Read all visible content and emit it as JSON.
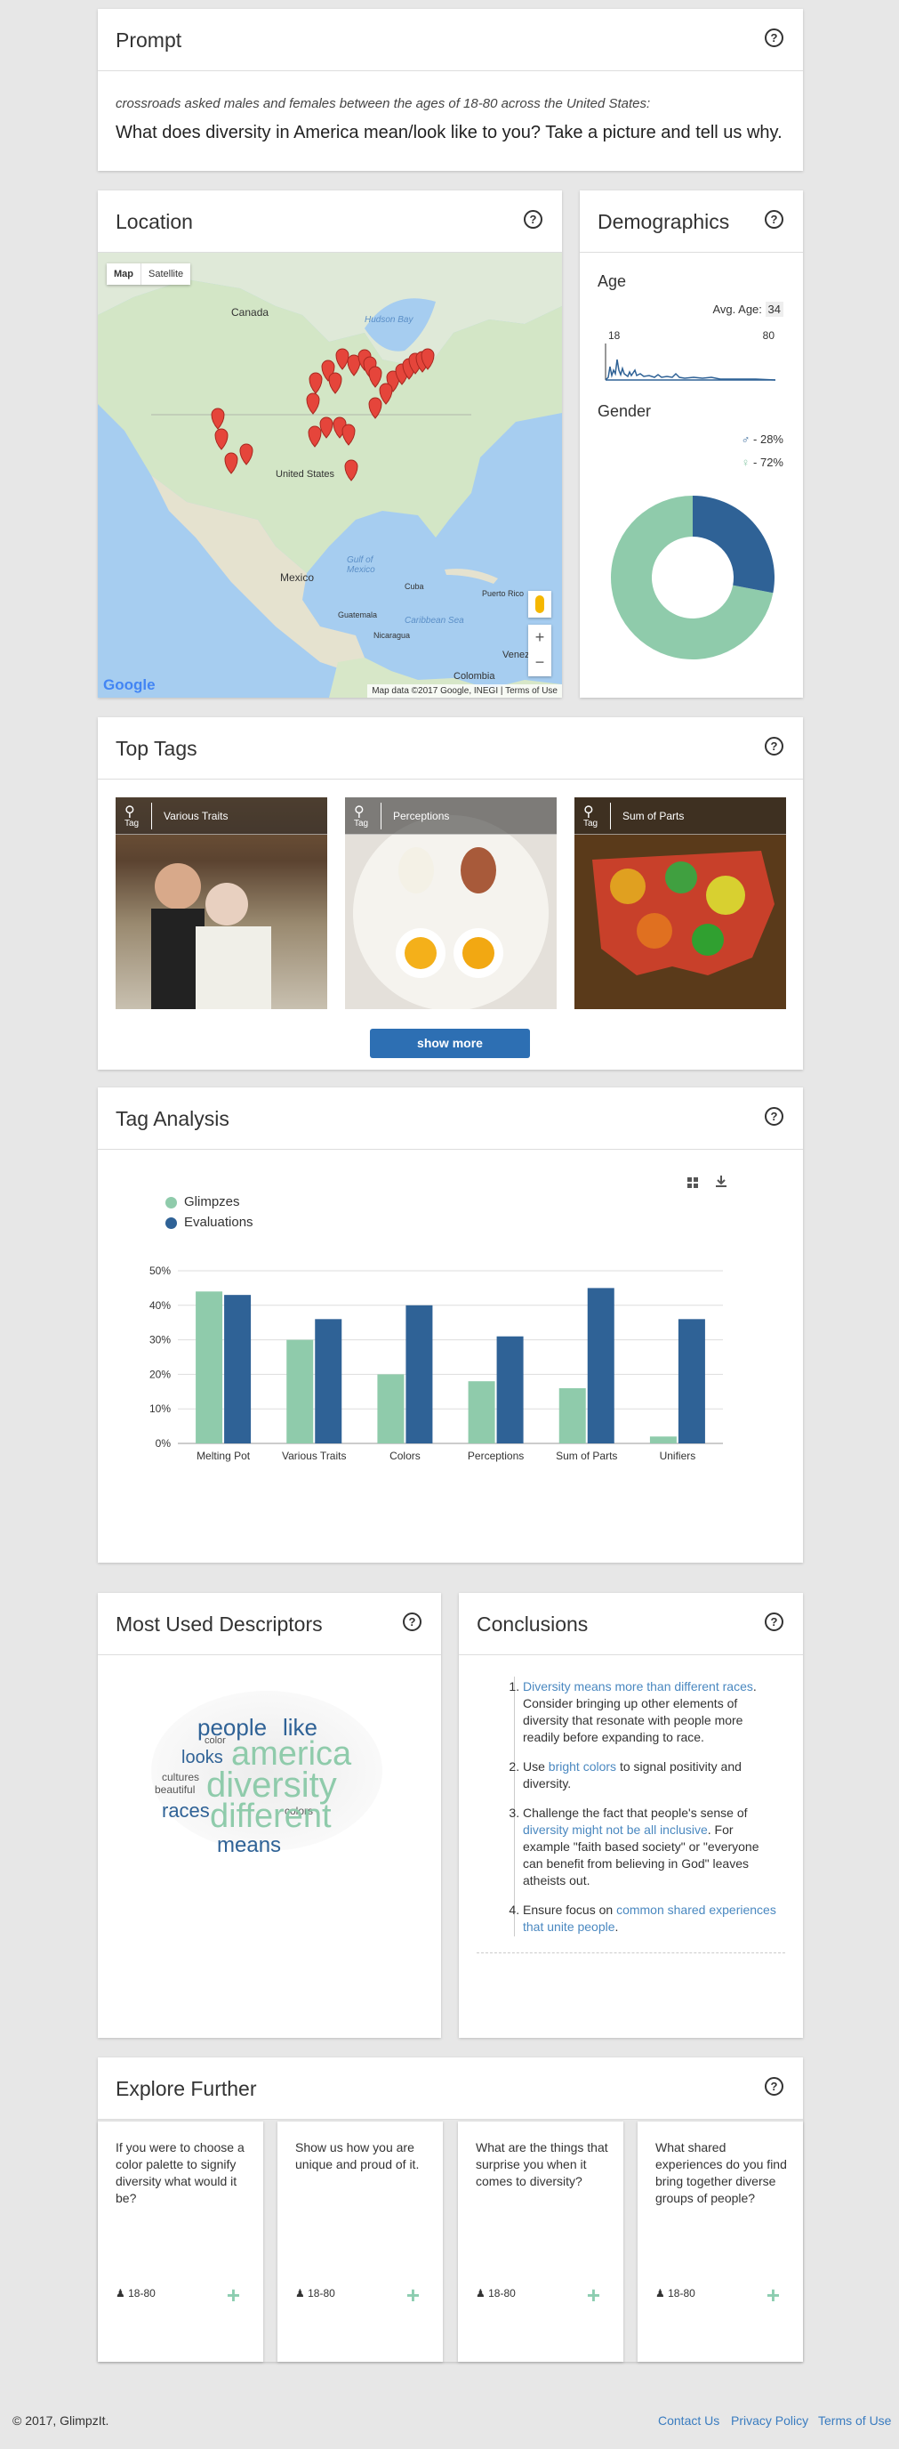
{
  "prompt": {
    "title": "Prompt",
    "help": "?",
    "subtitle": "crossroads asked males and females between the ages of 18-80 across the United States:",
    "question": "What does diversity in America mean/look like to you? Take a picture and tell us why."
  },
  "location": {
    "title": "Location",
    "help": "?",
    "map_button": "Map",
    "satellite_button": "Satellite",
    "google_logo": "Google",
    "map_data": "Map data ©2017 Google, INEGI",
    "terms": "Terms of Use",
    "labels": {
      "canada": "Canada",
      "hudson": "Hudson Bay",
      "mexico": "Mexico",
      "gulf": "Gulf of Mexico",
      "cuba": "Cuba",
      "caribbean": "Caribbean Sea",
      "venezuela": "Venezuela",
      "colombia": "Colombia",
      "guatemala": "Guatemala",
      "nicaragua": "Nicaragua",
      "puerto_rico": "Puerto Rico",
      "united_states": "United States"
    }
  },
  "demographics": {
    "title": "Demographics",
    "help": "?",
    "age_label": "Age",
    "avg_age_label": "Avg. Age:",
    "avg_age": "34",
    "age_min": "18",
    "age_max": "80",
    "gender_label": "Gender",
    "male_pct": "- 28%",
    "female_pct": "- 72%",
    "male_value": 28,
    "female_value": 72,
    "male_color": "#2f6296",
    "female_color": "#8fcbab"
  },
  "top_tags": {
    "title": "Top Tags",
    "help": "?",
    "items": [
      {
        "tag": "Tag",
        "name": "Various Traits"
      },
      {
        "tag": "Tag",
        "name": "Perceptions"
      },
      {
        "tag": "Tag",
        "name": "Sum of Parts"
      }
    ],
    "show_more": "show more"
  },
  "tag_analysis": {
    "title": "Tag Analysis",
    "help": "?"
  },
  "chart_data": {
    "type": "bar",
    "categories": [
      "Melting Pot",
      "Various Traits",
      "Colors",
      "Perceptions",
      "Sum of Parts",
      "Unifiers"
    ],
    "series": [
      {
        "name": "Glimpzes",
        "values": [
          44,
          30,
          20,
          18,
          16,
          2
        ],
        "color": "#8fcbab"
      },
      {
        "name": "Evaluations",
        "values": [
          43,
          36,
          40,
          31,
          45,
          36
        ],
        "color": "#2f6296"
      }
    ],
    "yticks": [
      "0%",
      "10%",
      "20%",
      "30%",
      "40%",
      "50%"
    ],
    "ylim": [
      0,
      50
    ],
    "grid": true,
    "legend": "top-left"
  },
  "descriptors": {
    "title": "Most Used Descriptors",
    "help": "?",
    "words": [
      "people",
      "like",
      "america",
      "diversity",
      "different",
      "means",
      "races",
      "looks",
      "cultures",
      "beautiful",
      "colors",
      "color"
    ]
  },
  "conclusions": {
    "title": "Conclusions",
    "help": "?",
    "items": [
      {
        "highlight": "Diversity means more than different races",
        "text": ". Consider bringing up other elements of diversity that resonate with people more readily before expanding to race."
      },
      {
        "pre": "Use ",
        "highlight": "bright colors",
        "text": " to signal positivity and diversity."
      },
      {
        "pre": "Challenge the fact that people's sense of ",
        "highlight": "diversity might not be all inclusive",
        "text": ". For example \"faith based society\" or \"everyone can benefit from believing in God\" leaves atheists out."
      },
      {
        "pre": "Ensure focus on ",
        "highlight": "common shared experiences that unite people",
        "text": "."
      }
    ]
  },
  "explore": {
    "title": "Explore Further",
    "help": "?",
    "cards": [
      {
        "text": "If you were to choose a color palette to signify diversity what would it be?",
        "age": "18-80"
      },
      {
        "text": "Show us how you are unique and proud of it.",
        "age": "18-80"
      },
      {
        "text": "What are the things that surprise you when it comes to diversity?",
        "age": "18-80"
      },
      {
        "text": "What shared experiences do you find bring together diverse groups of people?",
        "age": "18-80"
      }
    ]
  },
  "footer": {
    "copyright": "© 2017, GlimpzIt.",
    "contact": "Contact Us",
    "privacy": "Privacy Policy",
    "terms": "Terms of Use"
  }
}
